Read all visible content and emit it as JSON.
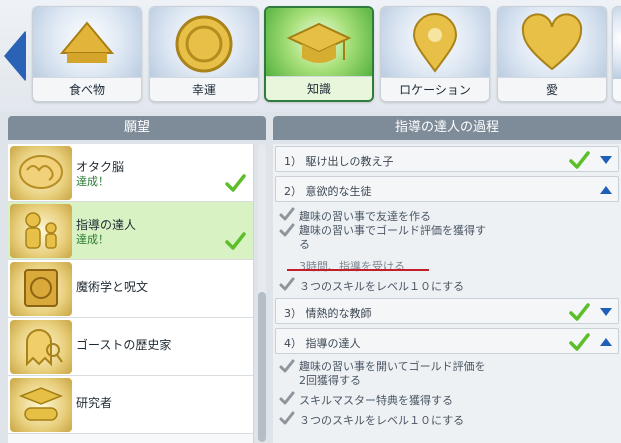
{
  "categories": [
    {
      "label": "食べ物",
      "icon": "food-trophy-icon",
      "selected": false
    },
    {
      "label": "幸運",
      "icon": "lucky-coin-icon",
      "selected": false
    },
    {
      "label": "知識",
      "icon": "graduation-cap-icon",
      "selected": true
    },
    {
      "label": "ロケーション",
      "icon": "location-pin-icon",
      "selected": false
    },
    {
      "label": "愛",
      "icon": "heart-icon",
      "selected": false
    }
  ],
  "aspirations_panel": {
    "header": "願望",
    "items": [
      {
        "name": "オタク脳",
        "status": "達成！",
        "completed": true,
        "selected": false,
        "icon": "brain-icon"
      },
      {
        "name": "指導の達人",
        "status": "達成！",
        "completed": true,
        "selected": true,
        "icon": "mentor-icon"
      },
      {
        "name": "魔術学と呪文",
        "status": "",
        "completed": false,
        "selected": false,
        "icon": "spellbook-icon"
      },
      {
        "name": "ゴーストの歴史家",
        "status": "",
        "completed": false,
        "selected": false,
        "icon": "ghost-icon"
      },
      {
        "name": "研究者",
        "status": "",
        "completed": false,
        "selected": false,
        "icon": "scroll-cap-icon"
      }
    ]
  },
  "progress_panel": {
    "header": "指導の達人の過程",
    "milestones": [
      {
        "title": "1） 駆け出しの教え子",
        "completed": true,
        "expanded": false
      },
      {
        "title": "2） 意欲的な生徒",
        "completed": false,
        "expanded": true,
        "tasks": [
          {
            "text": "趣味の習い事で友達を作る",
            "done": true
          },
          {
            "text": "趣味の習い事でゴールド評価を獲得する",
            "done": true
          },
          {
            "text": "3時間、指導を受ける",
            "done": false
          },
          {
            "text": "３つのスキルをレベル１０にする",
            "done": true
          }
        ]
      },
      {
        "title": "3） 情熱的な教師",
        "completed": true,
        "expanded": false
      },
      {
        "title": "4） 指導の達人",
        "completed": true,
        "expanded": true,
        "tasks": [
          {
            "text": "趣味の習い事を開いてゴールド評価を2回獲得する",
            "done": true
          },
          {
            "text": "スキルマスター特典を獲得する",
            "done": true
          },
          {
            "text": "３つのスキルをレベル１０にする",
            "done": true
          }
        ]
      }
    ]
  },
  "colors": {
    "accent_green": "#4fae3c",
    "check_green": "#5cbf2a",
    "arrow_blue": "#1f5fb8",
    "highlight_red": "#c21f2a"
  }
}
